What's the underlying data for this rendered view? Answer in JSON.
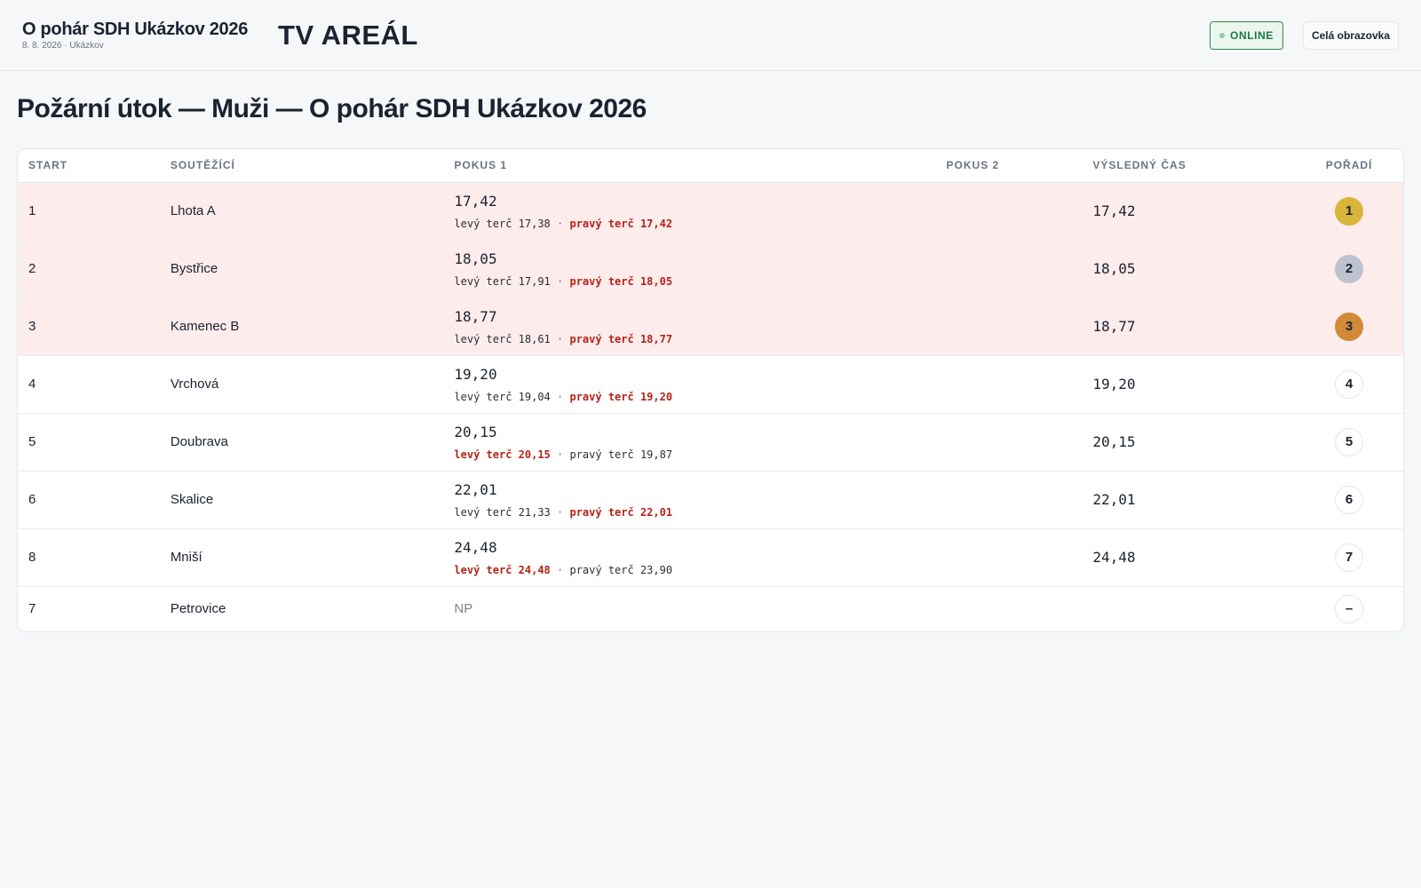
{
  "header": {
    "event_title": "O pohár SDH Ukázkov 2026",
    "event_subtitle": "8. 8. 2026 · Ukázkov",
    "screen_title": "TV AREÁL",
    "status_label": "ONLINE",
    "fullscreen_label": "Celá obrazovka"
  },
  "page": {
    "heading": "Požární útok — Muži — O pohár SDH Ukázkov 2026"
  },
  "table": {
    "columns": {
      "start": "START",
      "team": "SOUTĚŽÍCÍ",
      "attempt1": "POKUS 1",
      "attempt2": "POKUS 2",
      "final": "VÝSLEDNÝ ČAS",
      "rank": "POŘADÍ"
    },
    "separator": "·",
    "rows": [
      {
        "start": "1",
        "team": "Lhota A",
        "attempt1": "17,42",
        "left": "levý terč 17,38",
        "right": "pravý terč 17,42",
        "decisive": "right",
        "final": "17,42",
        "rank": "1",
        "medal": "gold",
        "podium": true
      },
      {
        "start": "2",
        "team": "Bystřice",
        "attempt1": "18,05",
        "left": "levý terč 17,91",
        "right": "pravý terč 18,05",
        "decisive": "right",
        "final": "18,05",
        "rank": "2",
        "medal": "silver",
        "podium": true
      },
      {
        "start": "3",
        "team": "Kamenec B",
        "attempt1": "18,77",
        "left": "levý terč 18,61",
        "right": "pravý terč 18,77",
        "decisive": "right",
        "final": "18,77",
        "rank": "3",
        "medal": "bronze",
        "podium": true
      },
      {
        "start": "4",
        "team": "Vrchová",
        "attempt1": "19,20",
        "left": "levý terč 19,04",
        "right": "pravý terč 19,20",
        "decisive": "right",
        "final": "19,20",
        "rank": "4",
        "medal": "",
        "podium": false
      },
      {
        "start": "5",
        "team": "Doubrava",
        "attempt1": "20,15",
        "left": "levý terč 20,15",
        "right": "pravý terč 19,87",
        "decisive": "left",
        "final": "20,15",
        "rank": "5",
        "medal": "",
        "podium": false
      },
      {
        "start": "6",
        "team": "Skalice",
        "attempt1": "22,01",
        "left": "levý terč 21,33",
        "right": "pravý terč 22,01",
        "decisive": "right",
        "final": "22,01",
        "rank": "6",
        "medal": "",
        "podium": false
      },
      {
        "start": "8",
        "team": "Mniší",
        "attempt1": "24,48",
        "left": "levý terč 24,48",
        "right": "pravý terč 23,90",
        "decisive": "left",
        "final": "24,48",
        "rank": "7",
        "medal": "",
        "podium": false
      },
      {
        "start": "7",
        "team": "Petrovice",
        "attempt1": "NP",
        "left": "",
        "right": "",
        "decisive": "",
        "final": "",
        "rank": "–",
        "medal": "",
        "podium": false
      }
    ]
  },
  "colors": {
    "podium_row": "#fdecec",
    "highlight_time": "#b42318",
    "gold": "#d9b53c",
    "silver": "#bcc3cf",
    "bronze": "#d08a38",
    "online": "#1f7a43"
  }
}
